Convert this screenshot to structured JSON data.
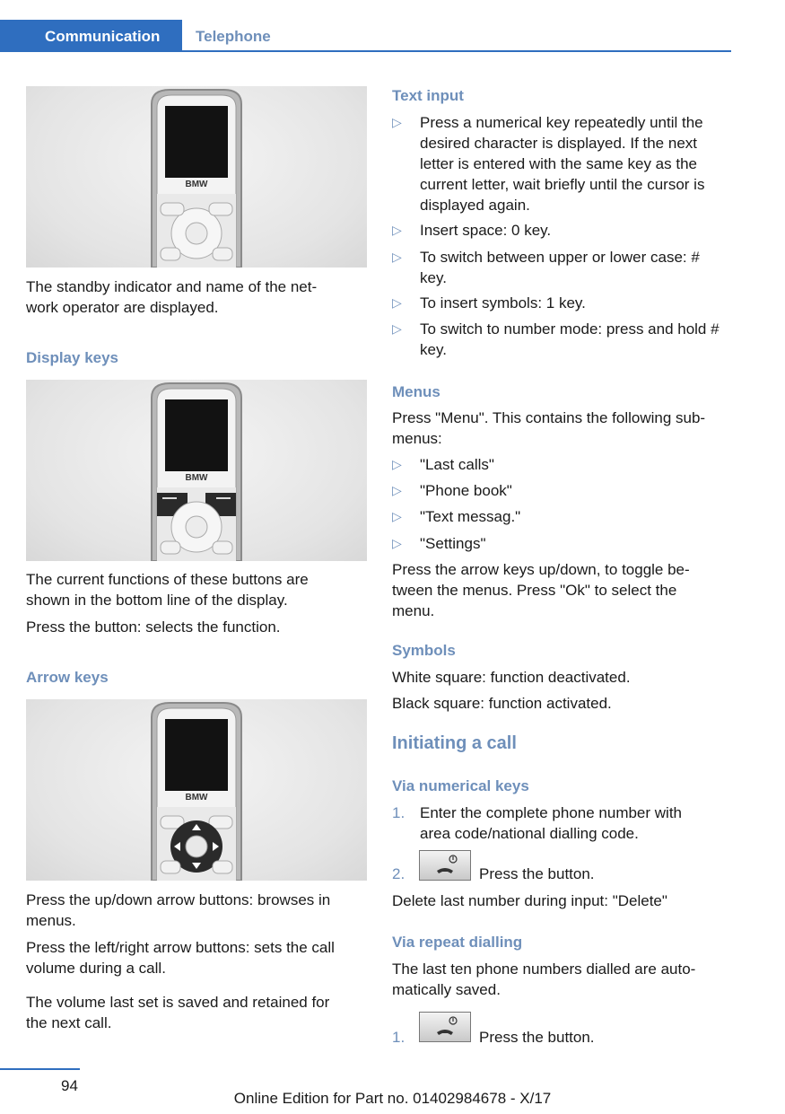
{
  "header": {
    "section": "Communication",
    "subsection": "Telephone"
  },
  "colors": {
    "accent": "#2f6ebf",
    "heading": "#6e8fba"
  },
  "left": {
    "phone_logo": "BMW",
    "caption1": "The standby indicator and name of the net‐work operator are displayed.",
    "display_keys_heading": "Display keys",
    "caption2a": "The current functions of these buttons are shown in the bottom line of the display.",
    "caption2b": "Press the button: selects the function.",
    "arrow_keys_heading": "Arrow keys",
    "caption3a": "Press the up/down arrow buttons: browses in menus.",
    "caption3b": "Press the left/right arrow buttons: sets the call volume during a call.",
    "caption3c": "The volume last set is saved and retained for the next call."
  },
  "right": {
    "text_input_heading": "Text input",
    "bullet_mark": "▷",
    "text_input_items": [
      "Press a numerical key repeatedly until the desired character is displayed. If the next letter is entered with the same key as the current letter, wait briefly until the cursor is displayed again.",
      "Insert space: 0 key.",
      "To switch between upper or lower case: # key.",
      "To insert symbols: 1 key.",
      "To switch to number mode: press and hold # key."
    ],
    "menus_heading": "Menus",
    "menus_intro": "Press \"Menu\". This contains the following sub-menus:",
    "menu_items": [
      "\"Last calls\"",
      "\"Phone book\"",
      "\"Text messag.\"",
      "\"Settings\""
    ],
    "menus_outro": "Press the arrow keys up/down, to toggle be‐tween the menus. Press \"Ok\" to select the menu.",
    "symbols_heading": "Symbols",
    "symbols_white": "White square: function deactivated.",
    "symbols_black": "Black square: function activated.",
    "initiating_heading": "Initiating a call",
    "numerical_heading": "Via numerical keys",
    "step1_num": "1.",
    "step1": "Enter the complete phone number with area code/national dialling code.",
    "step2_num": "2.",
    "step2": "Press the button.",
    "delete_note": "Delete last number during input: \"Delete\"",
    "repeat_heading": "Via repeat dialling",
    "repeat_text": "The last ten phone numbers dialled are auto‐matically saved.",
    "repeat_step_num": "1.",
    "repeat_step": "Press the button."
  },
  "footer": {
    "page_number": "94",
    "edition": "Online Edition for Part no. 01402984678 - X/17"
  }
}
